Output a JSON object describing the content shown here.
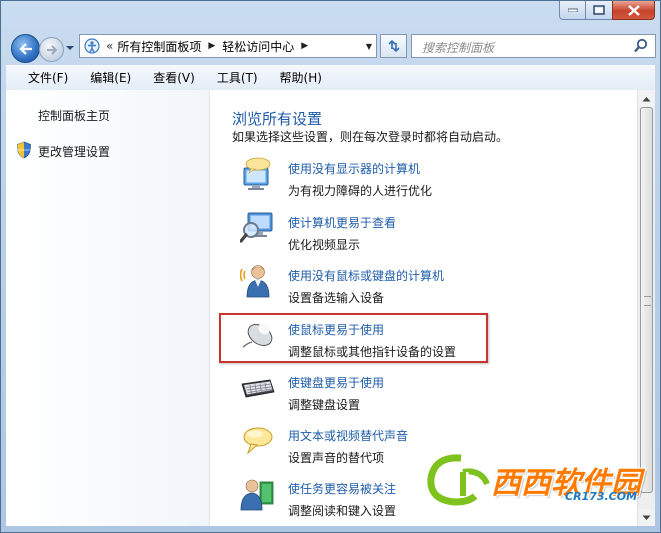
{
  "window": {
    "controls": [
      "minimize-icon",
      "maximize-icon",
      "close-icon"
    ]
  },
  "nav": {
    "breadcrumb_sep": "«",
    "crumbs": [
      "所有控制面板项",
      "轻松访问中心"
    ],
    "search_placeholder": "搜索控制面板"
  },
  "menu": [
    "文件(F)",
    "编辑(E)",
    "查看(V)",
    "工具(T)",
    "帮助(H)"
  ],
  "sidebar": {
    "home": "控制面板主页",
    "admin": "更改管理设置"
  },
  "main": {
    "heading": "浏览所有设置",
    "description": "如果选择这些设置，则在每次登录时都将自动启动。",
    "items": [
      {
        "link": "使用没有显示器的计算机",
        "sub": "为有视力障碍的人进行优化",
        "icon": "narrator-icon"
      },
      {
        "link": "使计算机更易于查看",
        "sub": "优化视频显示",
        "icon": "magnifier-icon"
      },
      {
        "link": "使用没有鼠标或键盘的计算机",
        "sub": "设置备选输入设备",
        "icon": "user-speech-icon"
      },
      {
        "link": "使鼠标更易于使用",
        "sub": "调整鼠标或其他指针设备的设置",
        "icon": "mouse-icon"
      },
      {
        "link": "使键盘更易于使用",
        "sub": "调整键盘设置",
        "icon": "keyboard-icon"
      },
      {
        "link": "用文本或视频替代声音",
        "sub": "设置声音的替代项",
        "icon": "speech-bubble-icon"
      },
      {
        "link": "使任务更容易被关注",
        "sub": "调整阅读和键入设置",
        "icon": "user-book-icon"
      }
    ]
  },
  "watermark": {
    "name": "西西软件园",
    "url": "CR173.COM"
  },
  "colors": {
    "link": "#1f5ca8",
    "heading": "#1e5aa8",
    "highlight": "#c7352e",
    "watermark": "#ff7a00"
  }
}
